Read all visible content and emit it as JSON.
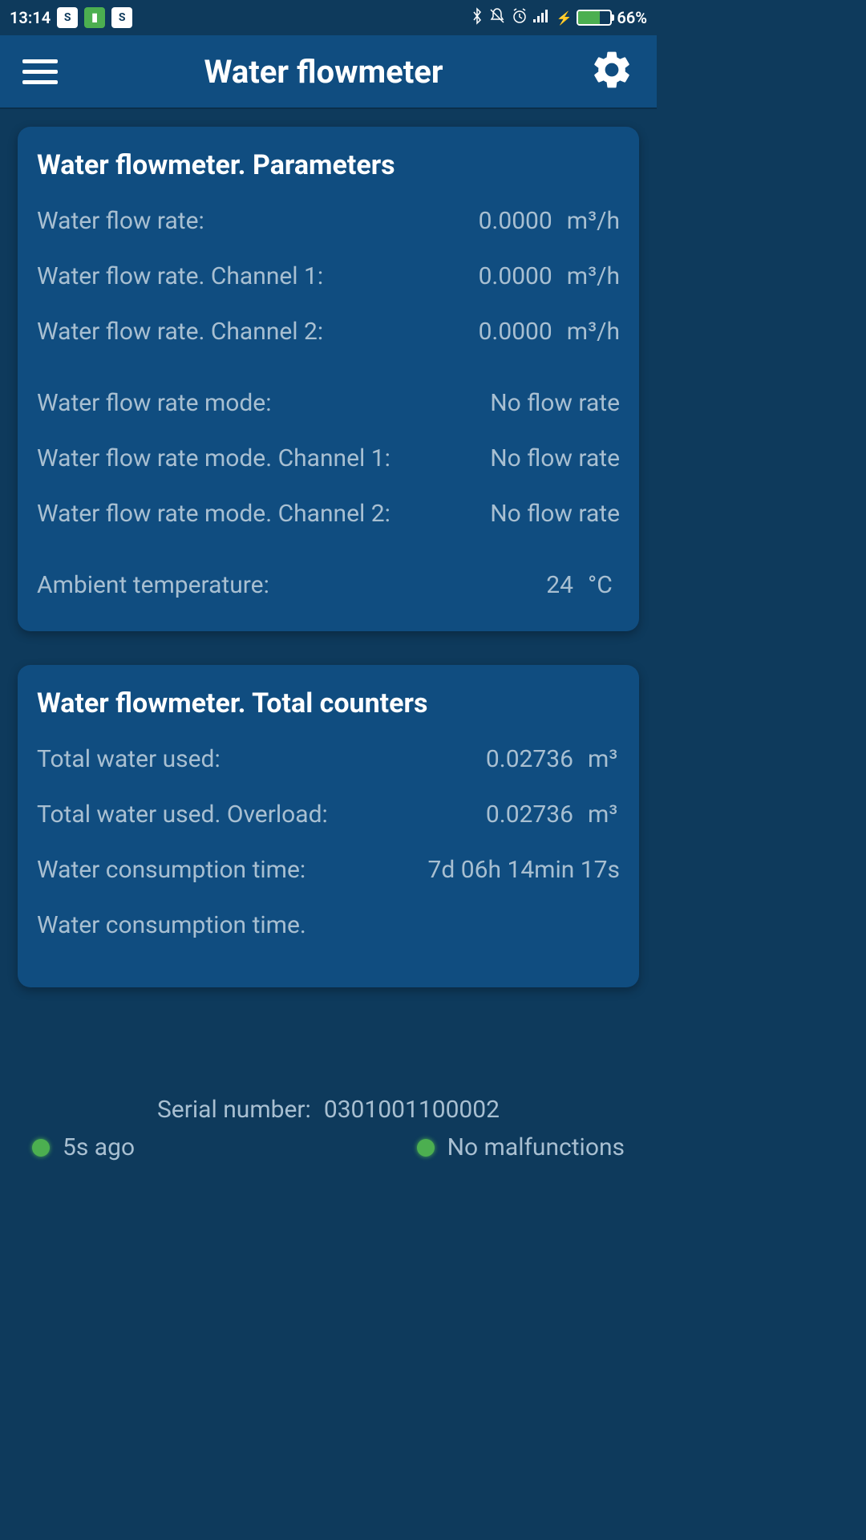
{
  "statusBar": {
    "time": "13:14",
    "battery": "66%"
  },
  "header": {
    "title": "Water flowmeter"
  },
  "cards": {
    "parameters": {
      "title": "Water flowmeter. Parameters",
      "flowRate": {
        "label": "Water flow rate:",
        "value": "0.0000",
        "unit": "m³/h"
      },
      "flowRateCh1": {
        "label": "Water flow rate. Channel 1:",
        "value": "0.0000",
        "unit": "m³/h"
      },
      "flowRateCh2": {
        "label": "Water flow rate. Channel 2:",
        "value": "0.0000",
        "unit": "m³/h"
      },
      "flowRateMode": {
        "label": "Water flow rate mode:",
        "value": "No flow rate"
      },
      "flowRateModeCh1": {
        "label": "Water flow rate mode. Channel 1:",
        "value": "No flow rate"
      },
      "flowRateModeCh2": {
        "label": "Water flow rate mode. Channel 2:",
        "value": "No flow rate"
      },
      "ambientTemp": {
        "label": "Ambient temperature:",
        "value": "24",
        "unit": "°C"
      }
    },
    "counters": {
      "title": "Water flowmeter. Total counters",
      "totalUsed": {
        "label": "Total water used:",
        "value": "0.02736",
        "unit": "m³"
      },
      "totalUsedOverload": {
        "label": "Total water used. Overload:",
        "value": "0.02736",
        "unit": "m³"
      },
      "consumptionTime": {
        "label": "Water consumption time:",
        "value": "7d 06h 14min 17s"
      },
      "consumptionTimePartial": {
        "label": "Water consumption time."
      }
    }
  },
  "footer": {
    "serialLabel": "Serial number:",
    "serialValue": "0301001100002",
    "ago": "5s  ago",
    "malfunctions": "No malfunctions"
  }
}
